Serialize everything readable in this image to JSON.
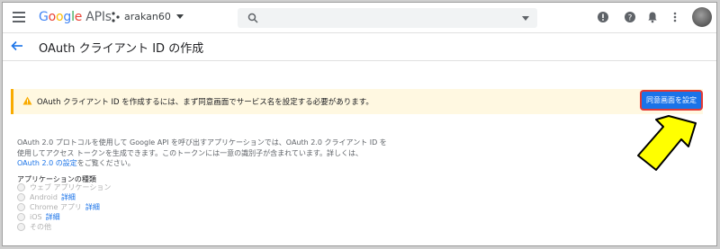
{
  "app": {
    "logo_google": [
      "G",
      "o",
      "o",
      "g",
      "l",
      "e"
    ],
    "logo_suffix": "APIs",
    "project_name": "arakan60",
    "search": {
      "value": "",
      "placeholder": ""
    }
  },
  "header": {
    "title": "OAuth クライアント ID の作成"
  },
  "warning": {
    "message": "OAuth クライアント ID を作成するには、まず同意画面でサービス名を設定する必要があります。",
    "button_label": "同意画面を設定"
  },
  "description": {
    "line1": "OAuth 2.0 プロトコルを使用して Google API を呼び出すアプリケーションでは、OAuth 2.0 クライアント ID を",
    "line2": "使用してアクセス トークンを生成できます。このトークンには一意の識別子が含まれています。詳しくは、",
    "link": "OAuth 2.0 の設定",
    "line3_suffix": "をご覧ください。"
  },
  "app_type": {
    "label": "アプリケーションの種類",
    "options": [
      {
        "label": "ウェブ アプリケーション",
        "link": ""
      },
      {
        "label": "Android",
        "link": "詳細"
      },
      {
        "label": "Chrome アプリ",
        "link": "詳細"
      },
      {
        "label": "iOS",
        "link": "詳細"
      },
      {
        "label": "その他",
        "link": ""
      }
    ]
  },
  "colors": {
    "primary": "#1a73e8",
    "warning_bg": "#fff8e1",
    "warning_accent": "#f9ab00",
    "highlight_border": "#e53935",
    "arrow_fill": "#ffff00"
  }
}
